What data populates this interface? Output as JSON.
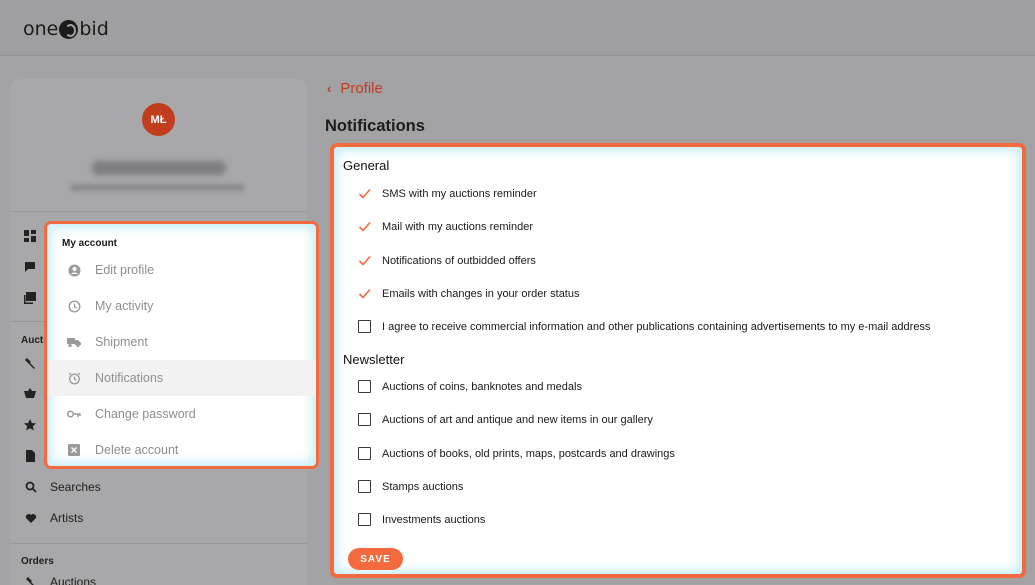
{
  "header": {
    "logo_left": "one",
    "logo_right": "bid"
  },
  "sidebar": {
    "avatar_initials": "MŁ",
    "section_auctions_partial": "Aucti",
    "items_bottom": [
      {
        "label": "Searches",
        "icon": "search-icon"
      },
      {
        "label": "Artists",
        "icon": "heart-icon"
      }
    ],
    "section_orders": "Orders",
    "orders_item": "Auctions"
  },
  "account_menu": {
    "title": "My account",
    "items": [
      {
        "label": "Edit profile",
        "icon": "user-circle-icon"
      },
      {
        "label": "My activity",
        "icon": "clock-icon"
      },
      {
        "label": "Shipment",
        "icon": "truck-icon"
      },
      {
        "label": "Notifications",
        "icon": "alarm-icon",
        "active": true
      },
      {
        "label": "Change password",
        "icon": "key-icon"
      },
      {
        "label": "Delete account",
        "icon": "delete-box-icon"
      }
    ]
  },
  "breadcrumb": {
    "back_label": "Profile"
  },
  "page": {
    "title": "Notifications"
  },
  "notifications": {
    "general_title": "General",
    "general": [
      {
        "label": "SMS with my auctions reminder",
        "checked": true
      },
      {
        "label": "Mail with my auctions reminder",
        "checked": true
      },
      {
        "label": "Notifications of outbidded offers",
        "checked": true
      },
      {
        "label": "Emails with changes in your order status",
        "checked": true
      },
      {
        "label": "I agree to receive commercial information and other publications containing advertisements to my e-mail address",
        "checked": false
      }
    ],
    "newsletter_title": "Newsletter",
    "newsletter": [
      {
        "label": "Auctions of coins, banknotes and medals",
        "checked": false
      },
      {
        "label": "Auctions of art and antique and new items in our gallery",
        "checked": false
      },
      {
        "label": "Auctions of books, old prints, maps, postcards and drawings",
        "checked": false
      },
      {
        "label": "Stamps auctions",
        "checked": false
      },
      {
        "label": "Investments auctions",
        "checked": false
      }
    ],
    "save_label": "SAVE"
  },
  "colors": {
    "accent": "#f26a3d",
    "brand_red": "#c23c1e"
  }
}
